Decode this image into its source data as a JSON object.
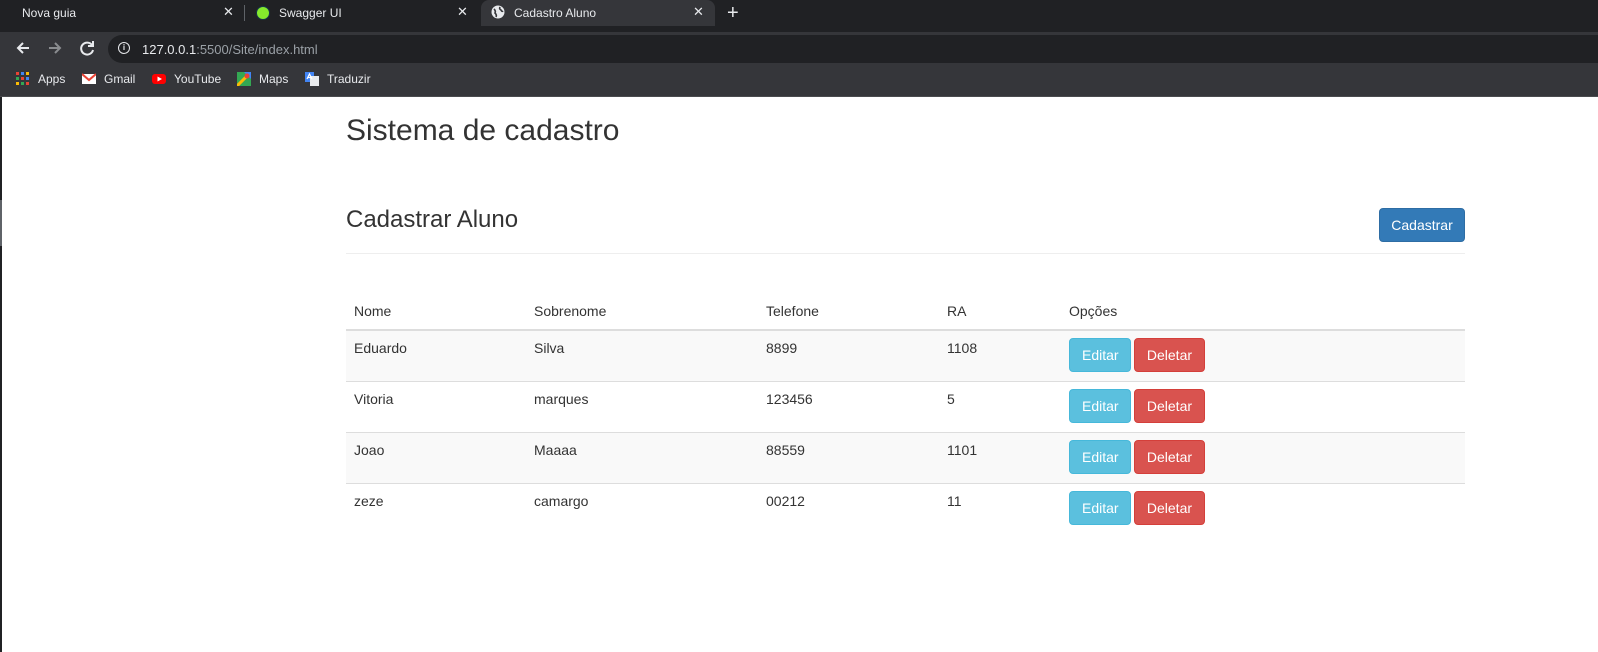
{
  "browser": {
    "tabs": [
      {
        "title": "Nova guia",
        "icon": "none"
      },
      {
        "title": "Swagger UI",
        "icon": "swagger-icon"
      },
      {
        "title": "Cadastro Aluno",
        "icon": "globe-icon",
        "active": true
      }
    ],
    "close_glyph": "✕",
    "new_tab_glyph": "+",
    "url_host": "127.0.0.1",
    "url_rest": ":5500/Site/index.html",
    "bookmarks": [
      "Apps",
      "Gmail",
      "YouTube",
      "Maps",
      "Traduzir"
    ]
  },
  "page": {
    "title": "Sistema de cadastro",
    "section_title": "Cadastrar Aluno",
    "register_button": "Cadastrar",
    "table": {
      "headers": [
        "Nome",
        "Sobrenome",
        "Telefone",
        "RA",
        "Opções"
      ],
      "rows": [
        {
          "nome": "Eduardo",
          "sobrenome": "Silva",
          "telefone": "8899",
          "ra": "1108"
        },
        {
          "nome": "Vitoria",
          "sobrenome": "marques",
          "telefone": "123456",
          "ra": "5"
        },
        {
          "nome": "Joao",
          "sobrenome": "Maaaa",
          "telefone": "88559",
          "ra": "1101"
        },
        {
          "nome": "zeze",
          "sobrenome": "camargo",
          "telefone": "00212",
          "ra": "11"
        }
      ],
      "edit_label": "Editar",
      "delete_label": "Deletar"
    }
  },
  "colors": {
    "primary": "#337ab7",
    "info": "#5bc0de",
    "danger": "#d9534f",
    "chrome_dark": "#202124",
    "chrome_toolbar": "#35363a"
  }
}
